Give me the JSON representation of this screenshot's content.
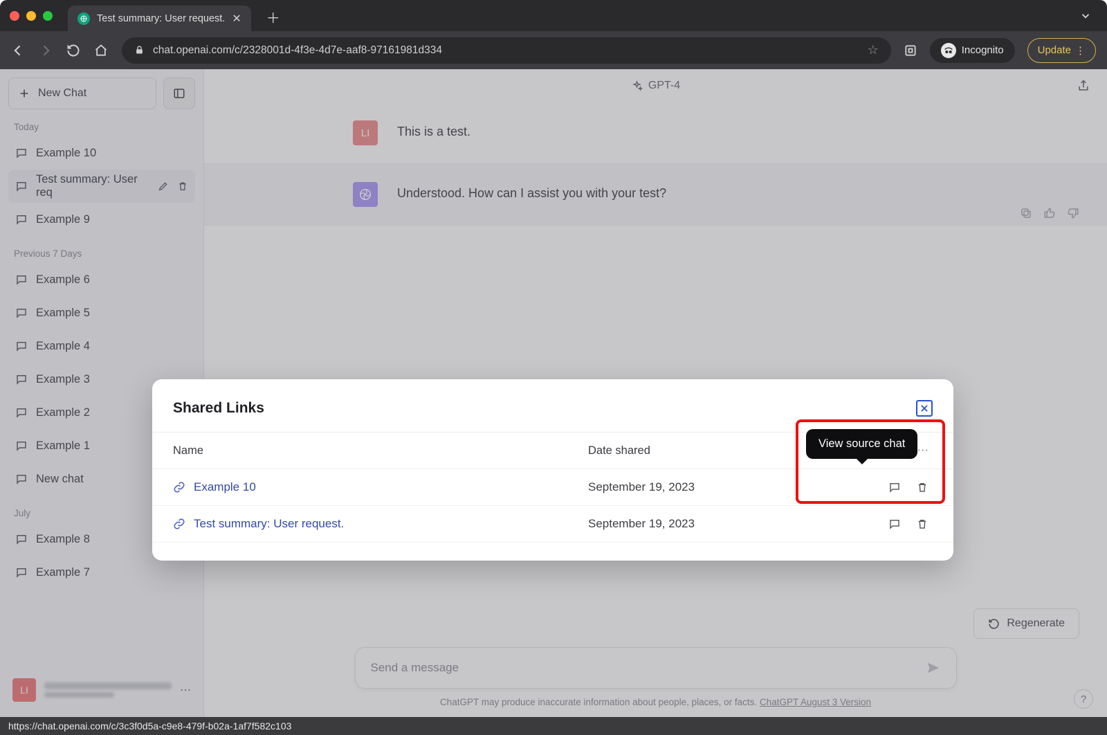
{
  "browser": {
    "tab_title": "Test summary: User request.",
    "url": "chat.openai.com/c/2328001d-4f3e-4d7e-aaf8-97161981d334",
    "incognito_label": "Incognito",
    "update_label": "Update",
    "status_url": "https://chat.openai.com/c/3c3f0d5a-c9e8-479f-b02a-1af7f582c103"
  },
  "sidebar": {
    "new_chat": "New Chat",
    "groups": [
      {
        "label": "Today",
        "items": [
          "Example 10",
          "Test summary: User req",
          "Example 9"
        ]
      },
      {
        "label": "Previous 7 Days",
        "items": [
          "Example 6",
          "Example 5",
          "Example 4",
          "Example 3",
          "Example 2",
          "Example 1",
          "New chat"
        ]
      },
      {
        "label": "July",
        "items": [
          "Example 8",
          "Example 7"
        ]
      }
    ],
    "active_index": {
      "group": 0,
      "item": 1
    },
    "user_initials": "LI"
  },
  "header": {
    "model": "GPT-4"
  },
  "messages": {
    "user_initials": "LI",
    "user_text": "This is a test.",
    "assistant_text": "Understood. How can I assist you with your test?"
  },
  "composer": {
    "regenerate": "Regenerate",
    "placeholder": "Send a message",
    "fineprint_prefix": "ChatGPT may produce inaccurate information about people, places, or facts. ",
    "fineprint_link": "ChatGPT August 3 Version"
  },
  "modal": {
    "title": "Shared Links",
    "columns": {
      "name": "Name",
      "date": "Date shared"
    },
    "rows": [
      {
        "name": "Example 10",
        "date": "September 19, 2023"
      },
      {
        "name": "Test summary: User request.",
        "date": "September 19, 2023"
      }
    ],
    "tooltip": "View source chat"
  }
}
